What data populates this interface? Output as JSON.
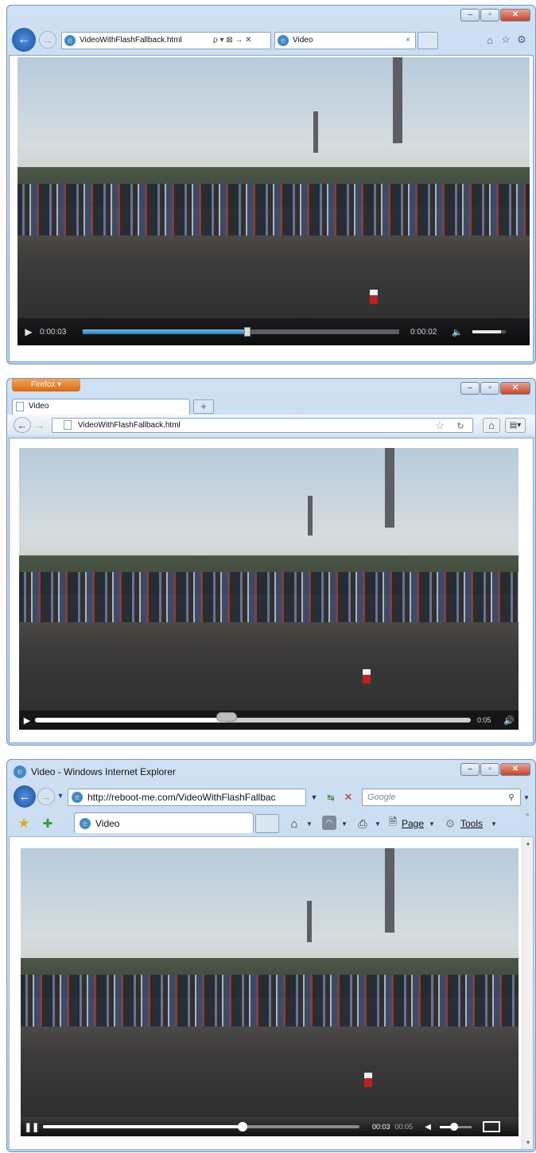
{
  "windows": [
    {
      "id": "ie9",
      "tab_address": "VideoWithFlashFallback.html",
      "tab_title": "Video",
      "address_actions": "ρ ▾ ⊠ → ✕",
      "player": {
        "time_elapsed": "0:00:03",
        "time_remaining": "0:00:02",
        "progress": 0.52,
        "volume": 0.85
      }
    },
    {
      "id": "firefox",
      "menu_button": "Firefox ▾",
      "tab_title": "Video",
      "new_tab": "+",
      "address": "VideoWithFlashFallback.html",
      "player": {
        "time": "0:05",
        "progress": 0.44
      }
    },
    {
      "id": "ie8",
      "title": "Video - Windows Internet Explorer",
      "address": "http://reboot-me.com/VideoWithFlashFallbac",
      "search_placeholder": "Google",
      "tab_title": "Video",
      "cmd_page": "Page",
      "cmd_tools": "Tools",
      "player": {
        "time_current": "00:03",
        "time_total": "00:05",
        "progress": 0.63,
        "volume": 0.45
      }
    }
  ],
  "icons": [
    "back-arrow-icon",
    "forward-arrow-icon",
    "home-icon",
    "star-icon",
    "gear-icon",
    "refresh-icon",
    "play-icon",
    "pause-icon",
    "volume-icon",
    "fullscreen-icon",
    "rss-icon",
    "print-icon",
    "search-icon"
  ]
}
